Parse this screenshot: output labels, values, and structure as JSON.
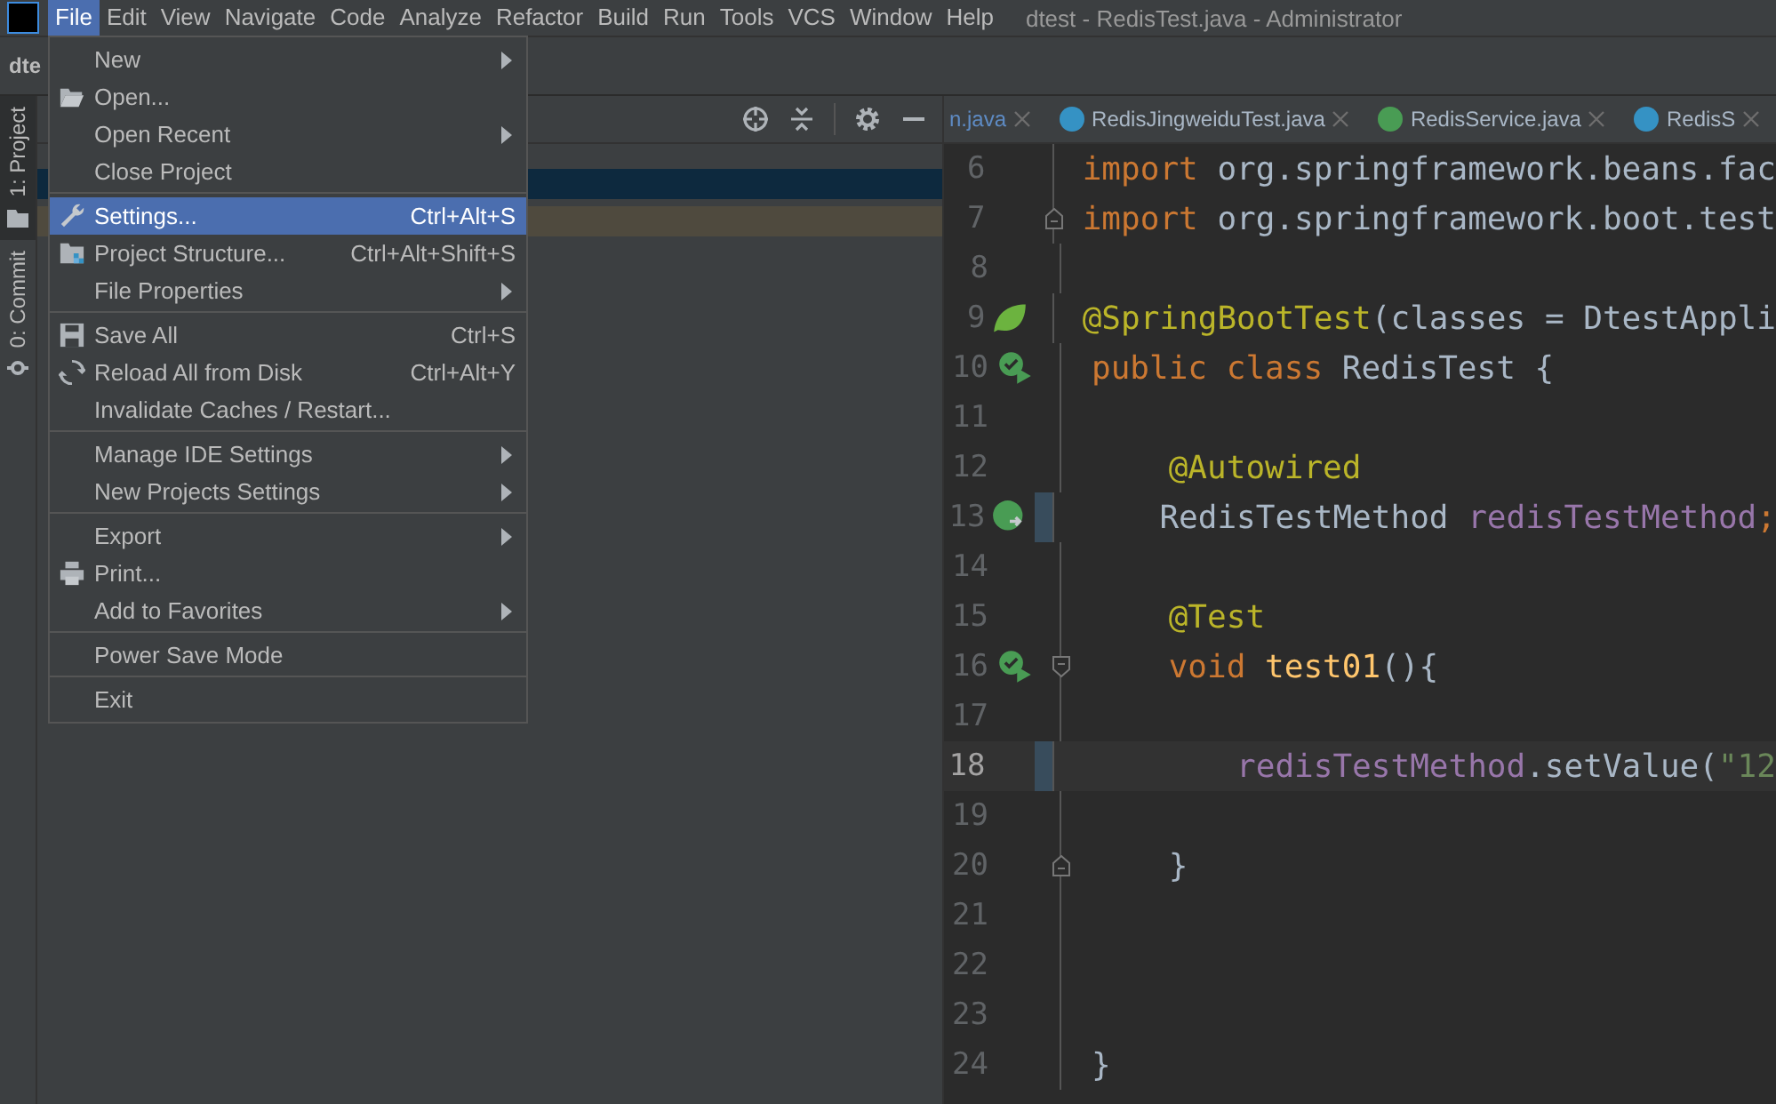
{
  "window": {
    "title": "dtest - RedisTest.java - Administrator"
  },
  "menubar": [
    {
      "label": "File",
      "selected": true
    },
    {
      "label": "Edit",
      "selected": false
    },
    {
      "label": "View",
      "selected": false
    },
    {
      "label": "Navigate",
      "selected": false
    },
    {
      "label": "Code",
      "selected": false
    },
    {
      "label": "Analyze",
      "selected": false
    },
    {
      "label": "Refactor",
      "selected": false
    },
    {
      "label": "Build",
      "selected": false
    },
    {
      "label": "Run",
      "selected": false
    },
    {
      "label": "Tools",
      "selected": false
    },
    {
      "label": "VCS",
      "selected": false
    },
    {
      "label": "Window",
      "selected": false
    },
    {
      "label": "Help",
      "selected": false
    }
  ],
  "breadcrumb": "dte",
  "side_tabs": [
    {
      "label": "1: Project",
      "selected": true
    },
    {
      "label": "0: Commit",
      "selected": false
    }
  ],
  "project_tree": {
    "rows": [
      {
        "kind": "selected"
      },
      {
        "kind": "highlighted"
      }
    ]
  },
  "file_menu": {
    "groups": [
      [
        {
          "label": "New",
          "submenu": true,
          "selected": false
        },
        {
          "label": "Open...",
          "kind": "folder",
          "selected": false
        },
        {
          "label": "Open Recent",
          "submenu": true,
          "selected": false
        },
        {
          "label": "Close Project",
          "selected": false
        }
      ],
      [
        {
          "label": "Settings...",
          "kind": "wrench",
          "shortcut": "Ctrl+Alt+S",
          "selected": true
        },
        {
          "label": "Project Structure...",
          "kind": "structure",
          "shortcut": "Ctrl+Alt+Shift+S",
          "selected": false
        },
        {
          "label": "File Properties",
          "submenu": true,
          "selected": false
        }
      ],
      [
        {
          "label": "Save All",
          "kind": "floppy",
          "shortcut": "Ctrl+S",
          "selected": false
        },
        {
          "label": "Reload All from Disk",
          "kind": "reload",
          "shortcut": "Ctrl+Alt+Y",
          "selected": false
        },
        {
          "label": "Invalidate Caches / Restart...",
          "selected": false
        }
      ],
      [
        {
          "label": "Manage IDE Settings",
          "submenu": true,
          "selected": false
        },
        {
          "label": "New Projects Settings",
          "submenu": true,
          "selected": false
        }
      ],
      [
        {
          "label": "Export",
          "submenu": true,
          "selected": false
        },
        {
          "label": "Print...",
          "kind": "printer",
          "selected": false
        },
        {
          "label": "Add to Favorites",
          "submenu": true,
          "selected": false
        }
      ],
      [
        {
          "label": "Power Save Mode",
          "selected": false
        }
      ],
      [
        {
          "label": "Exit",
          "selected": false
        }
      ]
    ]
  },
  "editor_tabs": [
    {
      "label": "n.java",
      "color": "#5e8bc4"
    },
    {
      "label": "RedisJingweiduTest.java",
      "kind": "class",
      "color": "#a9b7c6"
    },
    {
      "label": "RedisService.java",
      "kind": "interface",
      "color": "#a9b7c6"
    },
    {
      "label": "RedisS",
      "kind": "class",
      "color": "#a9b7c6"
    }
  ],
  "code_lines": [
    {
      "number": "6",
      "tokens": [
        {
          "kind": "keyword",
          "text": "import"
        },
        {
          "kind": "plain",
          "text": " org.springframework.beans.fac"
        }
      ]
    },
    {
      "number": "7",
      "fold_end": true,
      "tokens": [
        {
          "kind": "keyword",
          "text": "import"
        },
        {
          "kind": "plain",
          "text": " org.springframework.boot.test"
        }
      ]
    },
    {
      "number": "8"
    },
    {
      "number": "9",
      "kind": "leaf",
      "tokens": [
        {
          "kind": "annotation",
          "text": "@SpringBootTest"
        },
        {
          "kind": "plain",
          "text": "(classes = DtestAppli"
        }
      ]
    },
    {
      "number": "10",
      "kind": "run",
      "tokens": [
        {
          "kind": "keyword",
          "text": "public class"
        },
        {
          "kind": "plain",
          "text": " RedisTest {"
        }
      ]
    },
    {
      "number": "11"
    },
    {
      "number": "12",
      "tokens": [
        {
          "kind": "annotation",
          "text": "    @Autowired"
        }
      ]
    },
    {
      "number": "13",
      "kind": "bean",
      "changed": true,
      "tokens": [
        {
          "kind": "plain",
          "text": "    RedisTestMethod "
        },
        {
          "kind": "field",
          "text": "redisTestMethod"
        },
        {
          "kind": "keyword",
          "text": ";"
        }
      ]
    },
    {
      "number": "14"
    },
    {
      "number": "15",
      "tokens": [
        {
          "kind": "annotation",
          "text": "    @Test"
        }
      ]
    },
    {
      "number": "16",
      "kind": "run",
      "fold_start": true,
      "tokens": [
        {
          "kind": "keyword",
          "text": "    void"
        },
        {
          "kind": "method",
          "text": " test01"
        },
        {
          "kind": "plain",
          "text": "(){"
        }
      ]
    },
    {
      "number": "17"
    },
    {
      "number": "18",
      "current": true,
      "changed": true,
      "tokens": [
        {
          "kind": "field",
          "text": "        redisTestMethod"
        },
        {
          "kind": "plain",
          "text": ".setValue("
        },
        {
          "kind": "string",
          "text": "\"12"
        }
      ]
    },
    {
      "number": "19"
    },
    {
      "number": "20",
      "fold_end": true,
      "tokens": [
        {
          "kind": "plain",
          "text": "    }"
        }
      ]
    },
    {
      "number": "21"
    },
    {
      "number": "22"
    },
    {
      "number": "23"
    },
    {
      "number": "24",
      "tokens": [
        {
          "kind": "plain",
          "text": "}"
        }
      ]
    }
  ]
}
